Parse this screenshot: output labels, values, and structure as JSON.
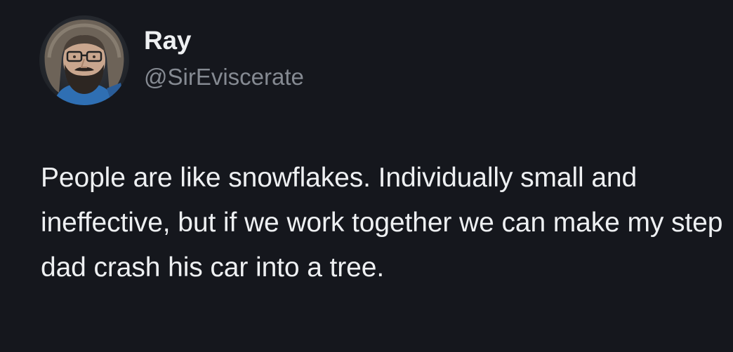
{
  "tweet": {
    "author_name": "Ray",
    "author_handle": "@SirEviscerate",
    "text": "People are like snowflakes. Individually small and ineffective, but if we work together we can make my step dad crash his car into a tree."
  },
  "colors": {
    "background": "#15171d",
    "primary_text": "#eef0f2",
    "secondary_text": "#858a92"
  }
}
